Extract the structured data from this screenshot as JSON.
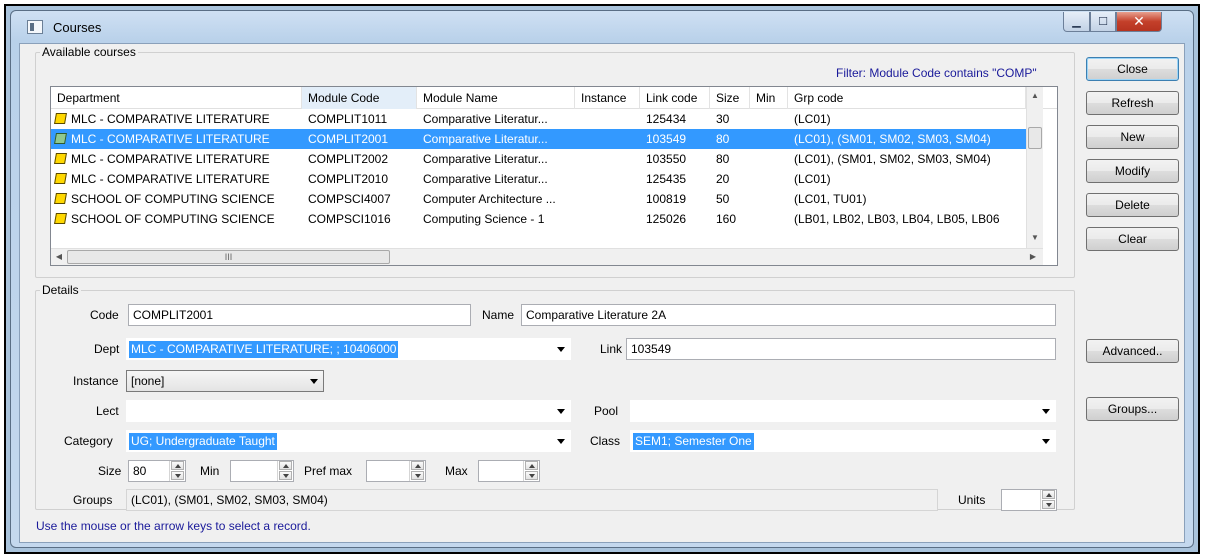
{
  "window": {
    "title": "Courses"
  },
  "available": {
    "label": "Available courses",
    "filter": "Filter: Module Code contains \"COMP\"",
    "columns": [
      "Department",
      "Module Code",
      "Module Name",
      "Instance",
      "Link code",
      "Size",
      "Min",
      "Grp code"
    ],
    "rows": [
      [
        "MLC - COMPARATIVE LITERATURE",
        "COMPLIT1011",
        "Comparative Literatur...",
        "",
        "125434",
        "30",
        "",
        "(LC01)"
      ],
      [
        "MLC - COMPARATIVE LITERATURE",
        "COMPLIT2001",
        "Comparative Literatur...",
        "",
        "103549",
        "80",
        "",
        "(LC01), (SM01, SM02, SM03, SM04)"
      ],
      [
        "MLC - COMPARATIVE LITERATURE",
        "COMPLIT2002",
        "Comparative Literatur...",
        "",
        "103550",
        "80",
        "",
        "(LC01), (SM01, SM02, SM03, SM04)"
      ],
      [
        "MLC - COMPARATIVE LITERATURE",
        "COMPLIT2010",
        "Comparative Literatur...",
        "",
        "125435",
        "20",
        "",
        "(LC01)"
      ],
      [
        "SCHOOL OF COMPUTING SCIENCE",
        "COMPSCI4007",
        "Computer Architecture ...",
        "",
        "100819",
        "50",
        "",
        "(LC01, TU01)"
      ],
      [
        "SCHOOL OF COMPUTING SCIENCE",
        "COMPSCI1016",
        "Computing Science - 1",
        "",
        "125026",
        "160",
        "",
        "(LB01, LB02, LB03, LB04, LB05, LB06"
      ]
    ],
    "selected_row": 1,
    "hscroll_glyph": "III"
  },
  "buttons": {
    "close": "Close",
    "refresh": "Refresh",
    "new": "New",
    "modify": "Modify",
    "delete": "Delete",
    "clear": "Clear",
    "advanced": "Advanced..",
    "groups": "Groups..."
  },
  "details": {
    "label": "Details",
    "code_label": "Code",
    "code": "COMPLIT2001",
    "name_label": "Name",
    "name": "Comparative Literature 2A",
    "dept_label": "Dept",
    "dept": "MLC - COMPARATIVE LITERATURE; ; 10406000",
    "link_label": "Link",
    "link": "103549",
    "instance_label": "Instance",
    "instance": "[none]",
    "lect_label": "Lect",
    "lect": "",
    "pool_label": "Pool",
    "pool": "",
    "category_label": "Category",
    "category": "UG; Undergraduate Taught",
    "class_label": "Class",
    "class": "SEM1; Semester One",
    "size_label": "Size",
    "size": "80",
    "min_label": "Min",
    "min": "",
    "prefmax_label": "Pref max",
    "prefmax": "",
    "max_label": "Max",
    "max": "",
    "groups_label": "Groups",
    "groups": "(LC01), (SM01, SM02, SM03, SM04)",
    "units_label": "Units",
    "units": ""
  },
  "status": "Use the mouse or the arrow keys to select a record."
}
